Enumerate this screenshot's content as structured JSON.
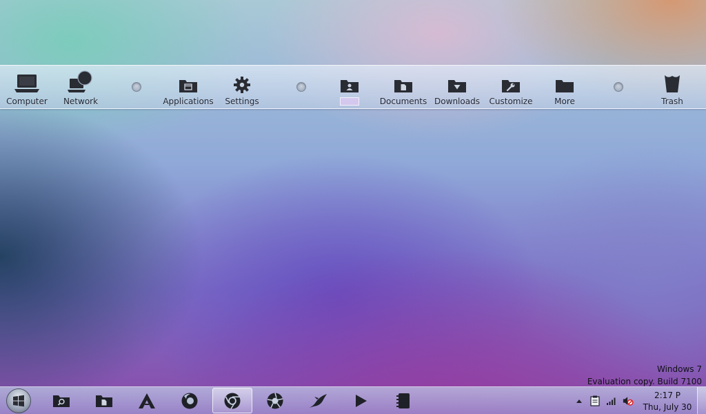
{
  "dock": {
    "items": [
      {
        "label": "Computer",
        "icon": "laptop-icon"
      },
      {
        "label": "Network",
        "icon": "network-icon"
      },
      {
        "label": "Applications",
        "icon": "applications-folder-icon"
      },
      {
        "label": "Settings",
        "icon": "gear-icon"
      },
      {
        "label": "",
        "icon": "user-folder-icon"
      },
      {
        "label": "Documents",
        "icon": "documents-folder-icon"
      },
      {
        "label": "Downloads",
        "icon": "downloads-folder-icon"
      },
      {
        "label": "Customize",
        "icon": "customize-folder-icon"
      },
      {
        "label": "More",
        "icon": "folder-icon"
      },
      {
        "label": "Trash",
        "icon": "trash-icon"
      }
    ]
  },
  "watermark": {
    "line1": "Windows 7",
    "line2": "Evaluation copy. Build 7100"
  },
  "taskbar": {
    "pinned": [
      {
        "icon": "search-folder-icon",
        "active": false
      },
      {
        "icon": "documents-folder-icon",
        "active": false
      },
      {
        "icon": "adobe-acrobat-icon",
        "active": false
      },
      {
        "icon": "firefox-icon",
        "active": false
      },
      {
        "icon": "chrome-icon",
        "active": true
      },
      {
        "icon": "aperture-icon",
        "active": false
      },
      {
        "icon": "bird-icon",
        "active": false
      },
      {
        "icon": "media-play-icon",
        "active": false
      },
      {
        "icon": "notebook-icon",
        "active": false
      }
    ],
    "tray": [
      "show-hidden-icons-arrow",
      "clipboard-icon",
      "network-signal-icon",
      "volume-muted-icon"
    ],
    "clock": {
      "time": "2:17 P",
      "date": "Thu, July 30"
    }
  },
  "colors": {
    "icon_dark": "#2a2c33",
    "dock_text": "#1e2330"
  }
}
